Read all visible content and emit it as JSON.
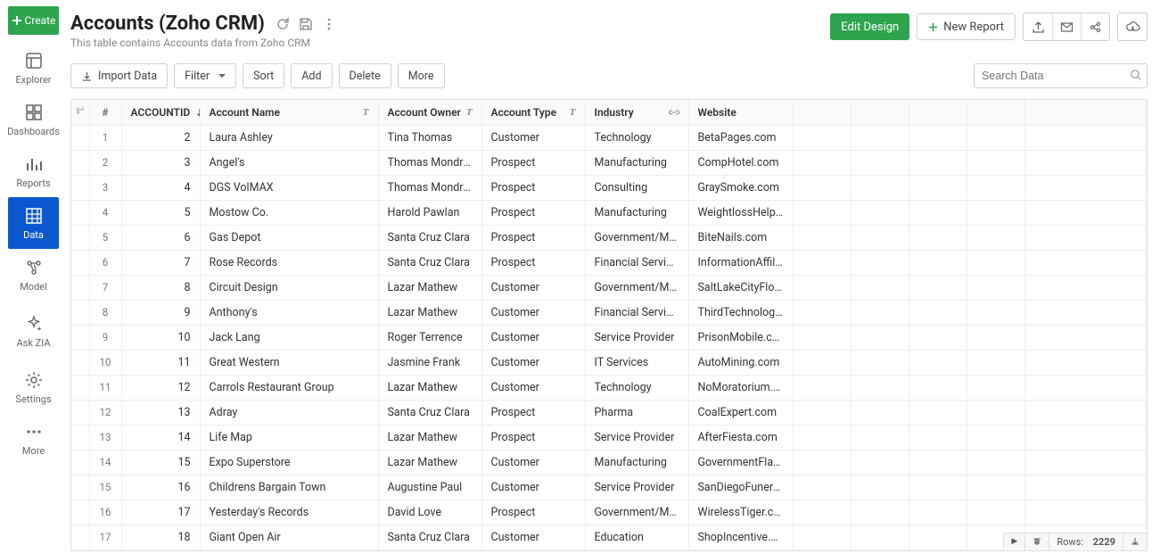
{
  "sidebar": {
    "create": "Create",
    "items": [
      {
        "key": "explorer",
        "label": "Explorer",
        "icon": "explorer-icon"
      },
      {
        "key": "dashboards",
        "label": "Dashboards",
        "icon": "dashboards-icon"
      },
      {
        "key": "reports",
        "label": "Reports",
        "icon": "reports-icon"
      },
      {
        "key": "data",
        "label": "Data",
        "icon": "data-icon",
        "active": true
      },
      {
        "key": "model",
        "label": "Model",
        "icon": "model-icon"
      },
      {
        "key": "ask-zia",
        "label": "Ask ZIA",
        "icon": "sparkle-icon"
      },
      {
        "key": "settings",
        "label": "Settings",
        "icon": "gear-icon"
      },
      {
        "key": "more",
        "label": "More",
        "icon": "more-icon"
      }
    ]
  },
  "header": {
    "title": "Accounts (Zoho CRM)",
    "subtitle": "This table contains Accounts data from Zoho CRM",
    "edit_design": "Edit Design",
    "new_report": "New Report"
  },
  "toolbar": {
    "import": "Import Data",
    "filter": "Filter",
    "sort": "Sort",
    "add": "Add",
    "delete": "Delete",
    "more": "More",
    "search_placeholder": "Search Data"
  },
  "table": {
    "columns": [
      "ACCOUNTID",
      "Account Name",
      "Account Owner",
      "Account Type",
      "Industry",
      "Website"
    ],
    "rows_label": "Rows:",
    "total_rows": "2229",
    "rows": [
      {
        "idx": 1,
        "id": 2,
        "name": "Laura Ashley",
        "owner": "Tina Thomas",
        "type": "Customer",
        "industry": "Technology",
        "website": "BetaPages.com"
      },
      {
        "idx": 2,
        "id": 3,
        "name": "Angel's",
        "owner": "Thomas Mondrake",
        "type": "Prospect",
        "industry": "Manufacturing",
        "website": "CompHotel.com"
      },
      {
        "idx": 3,
        "id": 4,
        "name": "DGS VolMAX",
        "owner": "Thomas Mondrake",
        "type": "Prospect",
        "industry": "Consulting",
        "website": "GraySmoke.com"
      },
      {
        "idx": 4,
        "id": 5,
        "name": "Mostow Co.",
        "owner": "Harold Pawlan",
        "type": "Prospect",
        "industry": "Manufacturing",
        "website": "WeightlossHelpline.com"
      },
      {
        "idx": 5,
        "id": 6,
        "name": "Gas Depot",
        "owner": "Santa Cruz Clara",
        "type": "Prospect",
        "industry": "Government/Military",
        "website": "BiteNails.com"
      },
      {
        "idx": 6,
        "id": 7,
        "name": "Rose Records",
        "owner": "Santa Cruz Clara",
        "type": "Prospect",
        "industry": "Financial Services",
        "website": "InformationAffiliate.com"
      },
      {
        "idx": 7,
        "id": 8,
        "name": "Circuit Design",
        "owner": "Lazar Mathew",
        "type": "Customer",
        "industry": "Government/Military",
        "website": "SaltLakeCityFlower.com"
      },
      {
        "idx": 8,
        "id": 9,
        "name": "Anthony's",
        "owner": "Lazar Mathew",
        "type": "Customer",
        "industry": "Financial Services",
        "website": "ThirdTechnology.com"
      },
      {
        "idx": 9,
        "id": 10,
        "name": "Jack Lang",
        "owner": "Roger Terrence",
        "type": "Customer",
        "industry": "Service Provider",
        "website": "PrisonMobile.com"
      },
      {
        "idx": 10,
        "id": 11,
        "name": "Great Western",
        "owner": "Jasmine Frank",
        "type": "Customer",
        "industry": "IT Services",
        "website": "AutoMining.com"
      },
      {
        "idx": 11,
        "id": 12,
        "name": "Carrols Restaurant Group",
        "owner": "Lazar Mathew",
        "type": "Customer",
        "industry": "Technology",
        "website": "NoMoratorium.com"
      },
      {
        "idx": 12,
        "id": 13,
        "name": "Adray",
        "owner": "Santa Cruz Clara",
        "type": "Prospect",
        "industry": "Pharma",
        "website": "CoalExpert.com"
      },
      {
        "idx": 13,
        "id": 14,
        "name": "Life Map",
        "owner": "Lazar Mathew",
        "type": "Prospect",
        "industry": "Service Provider",
        "website": "AfterFiesta.com"
      },
      {
        "idx": 14,
        "id": 15,
        "name": "Expo Superstore",
        "owner": "Lazar Mathew",
        "type": "Customer",
        "industry": "Manufacturing",
        "website": "GovernmentFlag.com"
      },
      {
        "idx": 15,
        "id": 16,
        "name": "Childrens Bargain Town",
        "owner": "Augustine Paul",
        "type": "Customer",
        "industry": "Service Provider",
        "website": "SanDiegoFuneralHome.com"
      },
      {
        "idx": 16,
        "id": 17,
        "name": "Yesterday's Records",
        "owner": "David Love",
        "type": "Prospect",
        "industry": "Government/Military",
        "website": "WirelessTiger.com"
      },
      {
        "idx": 17,
        "id": 18,
        "name": "Giant Open Air",
        "owner": "Santa Cruz Clara",
        "type": "Customer",
        "industry": "Education",
        "website": "ShopIncentive.com"
      }
    ]
  },
  "icons": {
    "explorer-icon": "<rect x='3' y='3' width='16' height='16' rx='2' fill='none' stroke='currentColor' stroke-width='1.5'/><path d='M3 8h16M8 8v11' stroke='currentColor' stroke-width='1.5'/>",
    "dashboards-icon": "<rect x='3' y='3' width='7' height='7' fill='none' stroke='currentColor' stroke-width='1.5'/><rect x='12' y='3' width='7' height='7' fill='none' stroke='currentColor' stroke-width='1.5'/><rect x='3' y='12' width='7' height='7' fill='none' stroke='currentColor' stroke-width='1.5'/><rect x='12' y='12' width='7' height='7' fill='none' stroke='currentColor' stroke-width='1.5'/>",
    "reports-icon": "<path d='M4 18V10m5 8V5m5 13v-6m5 6V8' stroke='currentColor' stroke-width='2'/>",
    "data-icon": "<rect x='3' y='3' width='16' height='16' fill='none' stroke='currentColor' stroke-width='1.5'/><path d='M3 9h16M3 14h16M9 3v16M15 3v16' stroke='currentColor' stroke-width='1.2'/>",
    "model-icon": "<circle cx='6' cy='6' r='2' fill='none' stroke='currentColor' stroke-width='1.4'/><circle cx='16' cy='6' r='2' fill='none' stroke='currentColor' stroke-width='1.4'/><circle cx='11' cy='16' r='2' fill='none' stroke='currentColor' stroke-width='1.4'/><path d='M7.5 7.5l2.5 6m1-6l2.5 6M8 6h6' stroke='currentColor' stroke-width='1.3'/>",
    "sparkle-icon": "<path d='M11 3l1.5 4 4 1.5-4 1.5L11 14l-1.5-4-4-1.5 4-1.5z' fill='none' stroke='currentColor' stroke-width='1.3'/><path d='M17 14l.7 1.8 1.8.7-1.8.7L17 19l-.7-1.8-1.8-.7 1.8-.7z' fill='currentColor'/>",
    "gear-icon": "<circle cx='11' cy='11' r='3' fill='none' stroke='currentColor' stroke-width='1.5'/><path d='M11 2v3m0 12v3M2 11h3m12 0h3M4.6 4.6l2 2m8.8 8.8l2 2M4.6 17.4l2-2m8.8-8.8l2-2' stroke='currentColor' stroke-width='1.5'/>",
    "more-icon": "<circle cx='5' cy='11' r='1.6' fill='currentColor'/><circle cx='11' cy='11' r='1.6' fill='currentColor'/><circle cx='17' cy='11' r='1.6' fill='currentColor'/>"
  }
}
